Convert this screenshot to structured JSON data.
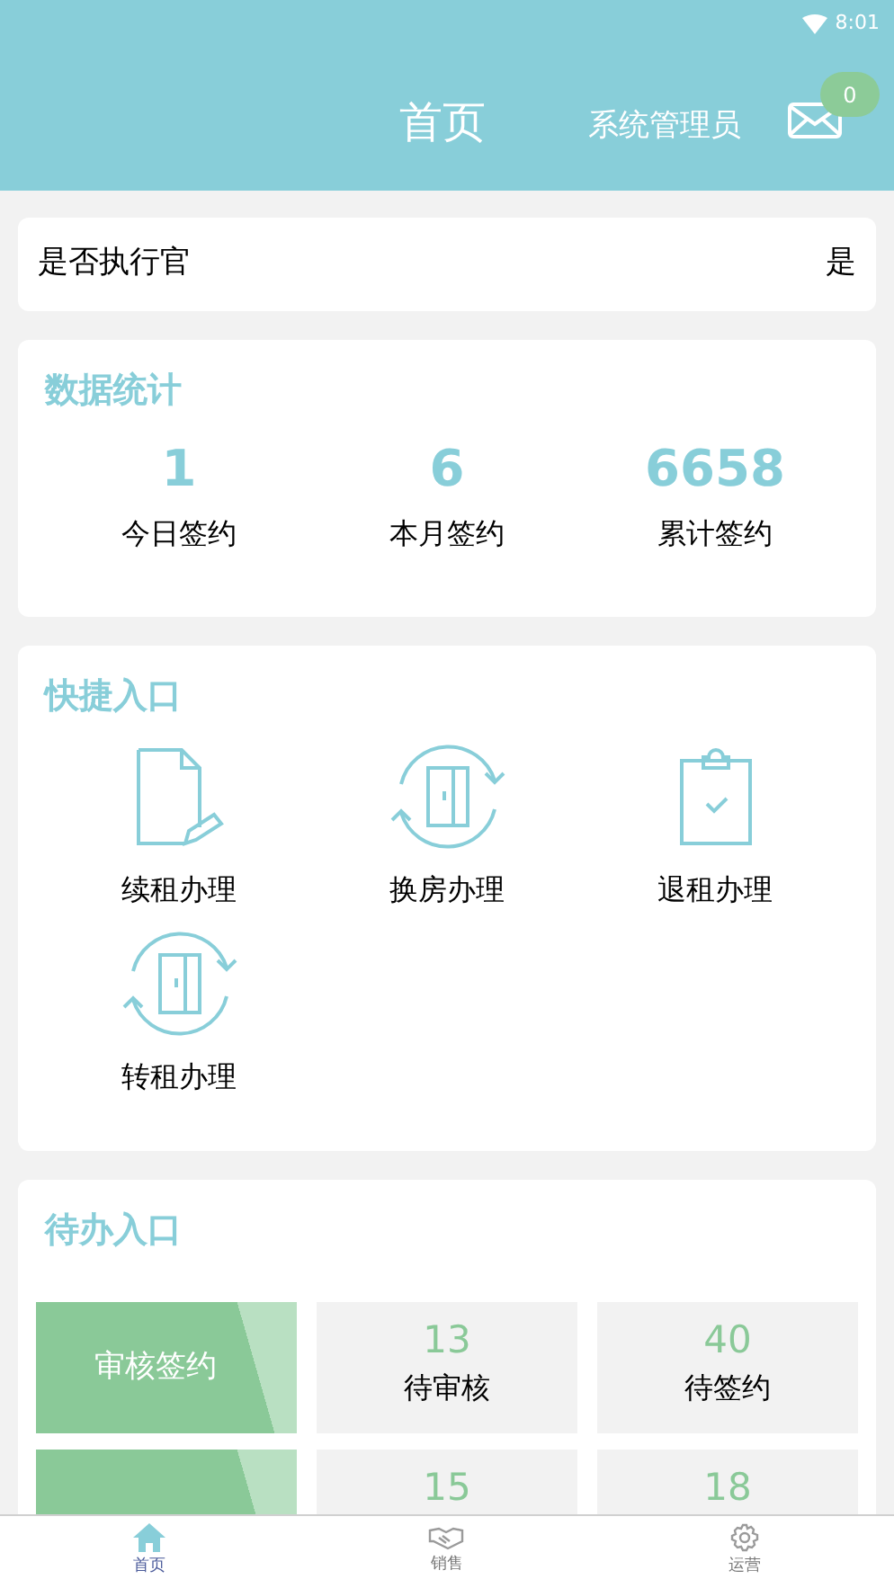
{
  "status_bar": {
    "time": "8:01"
  },
  "header": {
    "title": "首页",
    "user": "系统管理员",
    "message_count": "0"
  },
  "executive": {
    "label": "是否执行官",
    "value": "是"
  },
  "stats": {
    "title": "数据统计",
    "items": [
      {
        "value": "1",
        "label": "今日签约"
      },
      {
        "value": "6",
        "label": "本月签约"
      },
      {
        "value": "6658",
        "label": "累计签约"
      }
    ]
  },
  "quick": {
    "title": "快捷入口",
    "items": [
      {
        "kind": "renew",
        "label": "续租办理"
      },
      {
        "kind": "swap",
        "label": "换房办理"
      },
      {
        "kind": "checkout",
        "label": "退租办理"
      },
      {
        "kind": "swap",
        "label": "转租办理"
      }
    ]
  },
  "pending": {
    "title": "待办入口",
    "rows": [
      {
        "label": "审核签约",
        "cells": [
          {
            "value": "13",
            "label": "待审核"
          },
          {
            "value": "40",
            "label": "待签约"
          }
        ]
      },
      {
        "cells": [
          {
            "value": "15"
          },
          {
            "value": "18"
          }
        ]
      }
    ]
  },
  "tabs": [
    {
      "kind": "home",
      "label": "首页",
      "selected": true
    },
    {
      "kind": "sales",
      "label": "销售",
      "selected": false
    },
    {
      "kind": "ops",
      "label": "运营",
      "selected": false
    }
  ]
}
